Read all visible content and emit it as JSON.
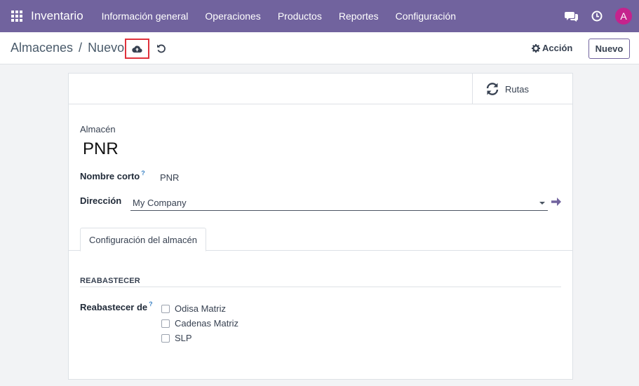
{
  "navbar": {
    "brand": "Inventario",
    "menu": [
      "Información general",
      "Operaciones",
      "Productos",
      "Reportes",
      "Configuración"
    ],
    "avatar_letter": "A",
    "color": "#71639e"
  },
  "control_panel": {
    "breadcrumb_parent": "Almacenes",
    "breadcrumb_separator": "/",
    "breadcrumb_current": "Nuevo",
    "save_icon": "cloud-upload-icon",
    "discard_icon": "undo-icon",
    "action_label": "Acción",
    "new_label": "Nuevo"
  },
  "form": {
    "routes_label": "Rutas",
    "warehouse_label": "Almacén",
    "warehouse_name": "PNR",
    "short_name_label": "Nombre corto",
    "short_name_value": "PNR",
    "help_mark": "?",
    "address_label": "Dirección",
    "address_value": "My Company",
    "tab_label": "Configuración del almacén",
    "section_title": "REABASTECER",
    "resupply_label": "Reabastecer de",
    "resupply_options": [
      "Odisa Matriz",
      "Cadenas Matriz",
      "SLP"
    ]
  }
}
